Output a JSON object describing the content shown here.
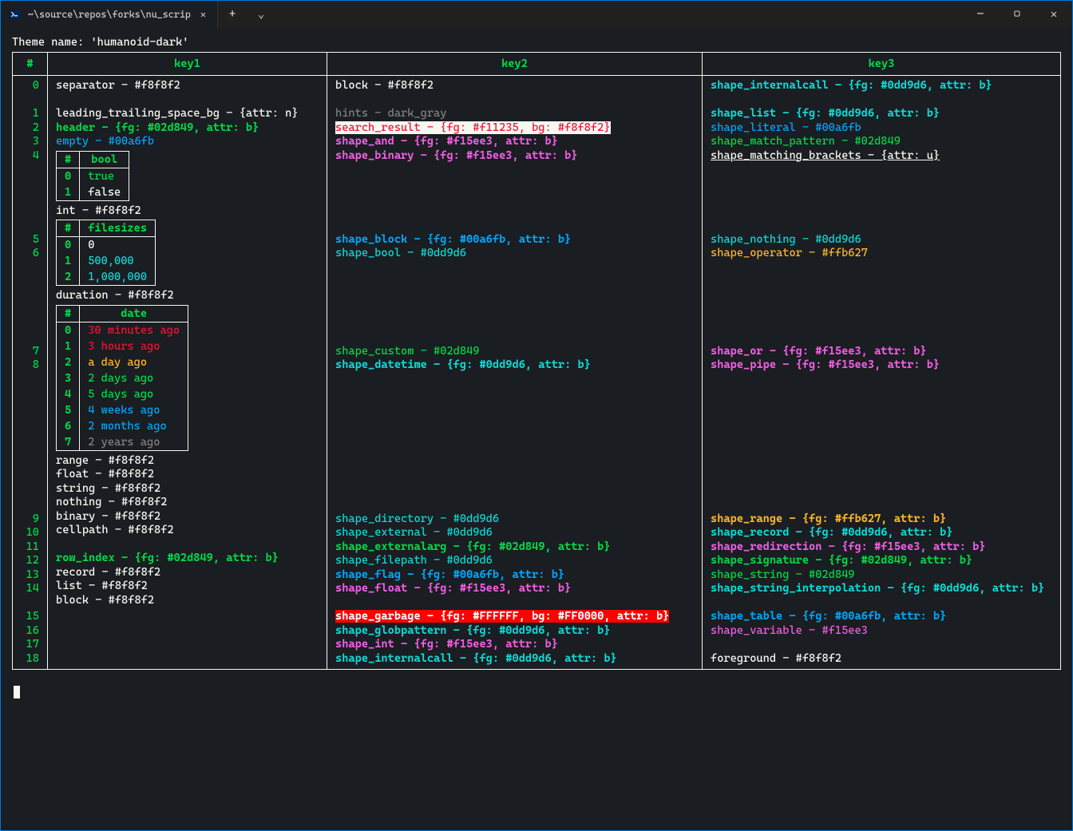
{
  "window": {
    "tab_title": "~\\source\\repos\\forks\\nu_scrip",
    "new_tab": "+",
    "dropdown": "⌄",
    "min": "—",
    "max": "▢",
    "close": "✕"
  },
  "theme_line": "Theme name: 'humanoid-dark'",
  "headers": {
    "idx": "#",
    "k1": "key1",
    "k2": "key2",
    "k3": "key3"
  },
  "nested_bool": {
    "h_idx": "#",
    "h_val": "bool",
    "rows": [
      {
        "i": "0",
        "v": "true"
      },
      {
        "i": "1",
        "v": "false"
      }
    ]
  },
  "nested_filesizes": {
    "h_idx": "#",
    "h_val": "filesizes",
    "rows": [
      {
        "i": "0",
        "v": "0"
      },
      {
        "i": "1",
        "v": "500,000"
      },
      {
        "i": "2",
        "v": "1,000,000"
      }
    ]
  },
  "nested_date": {
    "h_idx": "#",
    "h_val": "date",
    "rows": [
      {
        "i": "0",
        "v": "30 minutes ago"
      },
      {
        "i": "1",
        "v": "3 hours ago"
      },
      {
        "i": "2",
        "v": "a day ago"
      },
      {
        "i": "3",
        "v": "2 days ago"
      },
      {
        "i": "4",
        "v": "5 days ago"
      },
      {
        "i": "5",
        "v": "4 weeks ago"
      },
      {
        "i": "6",
        "v": "2 months ago"
      },
      {
        "i": "7",
        "v": "2 years ago"
      }
    ]
  },
  "idx": {
    "0": "0",
    "1": "1",
    "2": "2",
    "3": "3",
    "4": "4",
    "5": "5",
    "6": "6",
    "7": "7",
    "8": "8",
    "9": "9",
    "10": "10",
    "11": "11",
    "12": "12",
    "13": "13",
    "14": "14",
    "15": "15",
    "16": "16",
    "17": "17",
    "18": "18"
  },
  "k1": {
    "separator": "separator - #f8f8f2",
    "leading": "leading_trailing_space_bg - {attr: n}",
    "header": "header - {fg: #02d849, attr: b}",
    "empty": "empty - #00a6fb",
    "int": "int - #f8f8f2",
    "duration": "duration - #f8f8f2",
    "range": "range - #f8f8f2",
    "float": "float - #f8f8f2",
    "string": "string - #f8f8f2",
    "nothing": "nothing - #f8f8f2",
    "binary": "binary - #f8f8f2",
    "cellpath": "cellpath - #f8f8f2",
    "row_index": "row_index - {fg: #02d849, attr: b}",
    "record": "record - #f8f8f2",
    "list": "list - #f8f8f2",
    "block": "block - #f8f8f2"
  },
  "k2": {
    "block": "block - #f8f8f2",
    "hints": "hints - dark_gray",
    "search_result": "search_result - {fg: #f11235, bg: #f8f8f2}",
    "shape_and": "shape_and - {fg: #f15ee3, attr: b}",
    "shape_binary": "shape_binary - {fg: #f15ee3, attr: b}",
    "shape_block": "shape_block - {fg: #00a6fb, attr: b}",
    "shape_bool": "shape_bool - #0dd9d6",
    "shape_custom": "shape_custom - #02d849",
    "shape_datetime": "shape_datetime - {fg: #0dd9d6, attr: b}",
    "shape_directory": "shape_directory - #0dd9d6",
    "shape_external": "shape_external - #0dd9d6",
    "shape_externalarg": "shape_externalarg - {fg: #02d849, attr: b}",
    "shape_filepath": "shape_filepath - #0dd9d6",
    "shape_flag": "shape_flag - {fg: #00a6fb, attr: b}",
    "shape_float": "shape_float - {fg: #f15ee3, attr: b}",
    "shape_garbage": "shape_garbage - {fg: #FFFFFF, bg: #FF0000, attr: b}",
    "shape_globpattern": "shape_globpattern - {fg: #0dd9d6, attr: b}",
    "shape_int": "shape_int - {fg: #f15ee3, attr: b}",
    "shape_internalcall": "shape_internalcall - {fg: #0dd9d6, attr: b}"
  },
  "k3": {
    "shape_internalcall": "shape_internalcall - {fg: #0dd9d6, attr: b}",
    "shape_list": "shape_list - {fg: #0dd9d6, attr: b}",
    "shape_literal": "shape_literal - #00a6fb",
    "shape_match_pattern": "shape_match_pattern - #02d849",
    "shape_matching_brackets": "shape_matching_brackets - {attr: u}",
    "shape_nothing": "shape_nothing - #0dd9d6",
    "shape_operator": "shape_operator - #ffb627",
    "shape_or": "shape_or - {fg: #f15ee3, attr: b}",
    "shape_pipe": "shape_pipe - {fg: #f15ee3, attr: b}",
    "shape_range": "shape_range - {fg: #ffb627, attr: b}",
    "shape_record": "shape_record - {fg: #0dd9d6, attr: b}",
    "shape_redirection": "shape_redirection - {fg: #f15ee3, attr: b}",
    "shape_signature": "shape_signature - {fg: #02d849, attr: b}",
    "shape_string": "shape_string - #02d849",
    "shape_string_interpolation": "shape_string_interpolation - {fg: #0dd9d6, attr: b}",
    "shape_table": "shape_table - {fg: #00a6fb, attr: b}",
    "shape_variable": "shape_variable - #f15ee3",
    "foreground": "foreground - #f8f8f2"
  }
}
